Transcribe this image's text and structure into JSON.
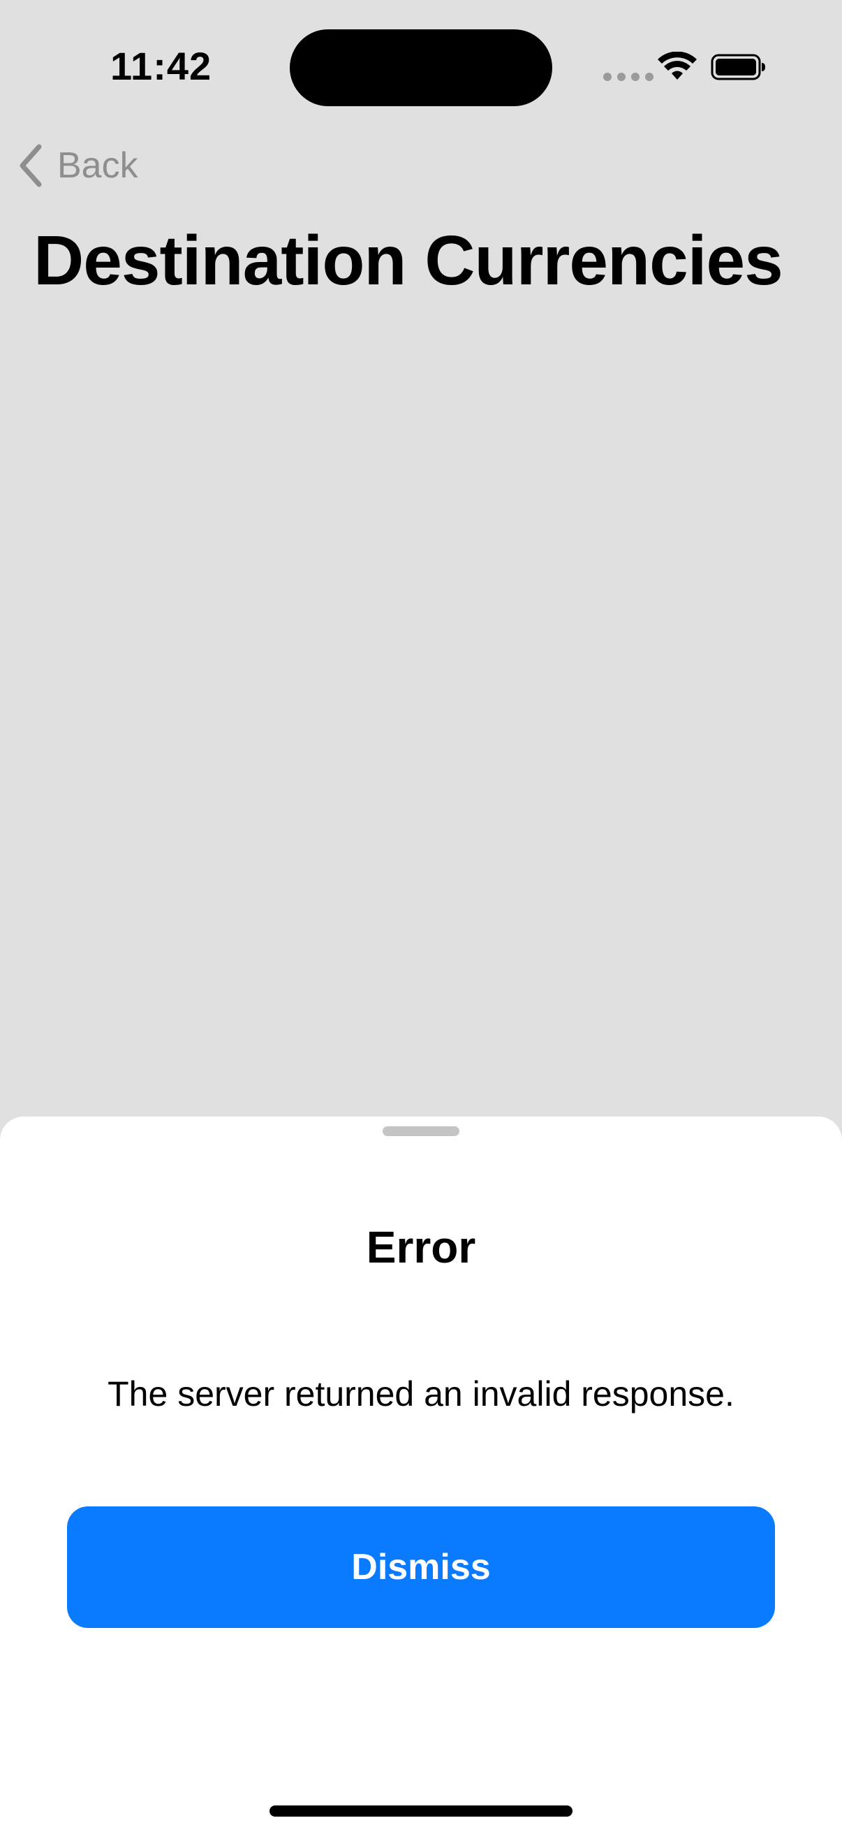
{
  "status_bar": {
    "time": "11:42",
    "icons": [
      "signal-dots-icon",
      "wifi-icon",
      "battery-icon"
    ]
  },
  "nav": {
    "back_label": "Back",
    "back_icon": "chevron-left-icon"
  },
  "page": {
    "title": "Destination Currencies"
  },
  "sheet": {
    "title": "Error",
    "message": "The server returned an invalid response.",
    "dismiss_label": "Dismiss"
  },
  "colors": {
    "background": "#e0e0e0",
    "sheet_background": "#ffffff",
    "accent": "#0a7aff",
    "back_text": "#8e8e8e"
  }
}
